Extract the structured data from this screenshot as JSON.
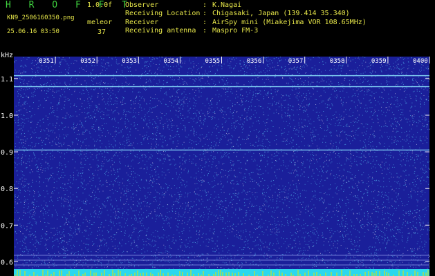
{
  "header": {
    "brand": "H R O F F T",
    "version": "1.0.0f",
    "filename": "KN9_2506160350.png",
    "mode": "meleor",
    "datetime": "25.06.16 03:50",
    "count": "37"
  },
  "info": [
    {
      "label": "Observer",
      "sep": ":",
      "value": "K.Nagai"
    },
    {
      "label": "Receiving Location",
      "sep": ":",
      "value": "Chigasaki, Japan (139.414 35.340)"
    },
    {
      "label": "Receiver",
      "sep": ":",
      "value": "AirSpy mini (Miakejima VOR 108.65MHz)"
    },
    {
      "label": "Receiving antenna",
      "sep": ":",
      "value": "Maspro FM-3"
    }
  ],
  "chart_data": {
    "type": "heatmap",
    "ylabel": "kHz",
    "y_ticks": [
      "1.1",
      "1.0",
      "0.9",
      "0.8",
      "0.7",
      "0.6"
    ],
    "y_tick_values": [
      1.1,
      1.0,
      0.9,
      0.8,
      0.7,
      0.6
    ],
    "ylim": [
      0.58,
      1.16
    ],
    "x_ticks": [
      "0351",
      "0352",
      "0353",
      "0354",
      "0355",
      "0356",
      "0357",
      "0358",
      "0359",
      "0400"
    ],
    "x_range_min": [
      "03:50",
      "04:00"
    ],
    "signal_lines_khz": [
      1.108,
      1.078,
      0.905
    ],
    "colors": {
      "background": "#1a1f9a",
      "noise_light": "#5fd7ff",
      "noise_white": "#ffffff",
      "signal": "#8ee8ff",
      "axis": "#ffffff",
      "bottom_band": "#2bd7ee",
      "bottom_spikes": "#e6e600",
      "text": "#e8e84a",
      "brand": "#3fd23f"
    }
  }
}
